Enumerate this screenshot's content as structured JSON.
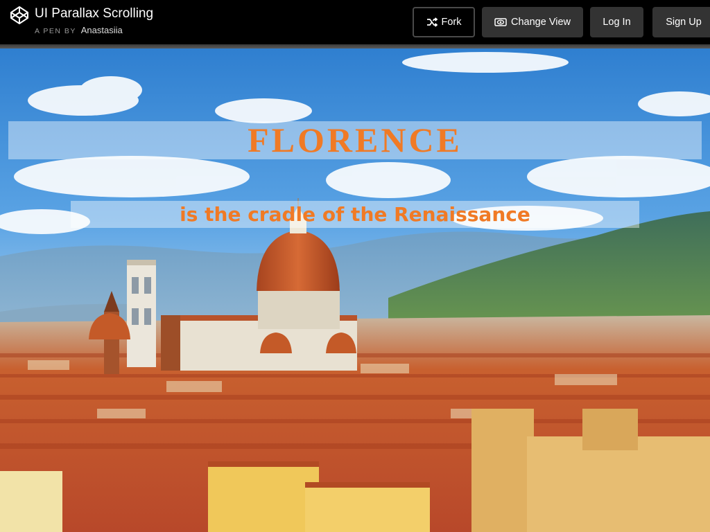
{
  "header": {
    "pen_title": "UI Parallax Scrolling",
    "byline_prefix": "A PEN BY",
    "author": "Anastasiia",
    "buttons": {
      "fork": "Fork",
      "change_view": "Change View",
      "log_in": "Log In",
      "sign_up": "Sign Up"
    }
  },
  "hero": {
    "headline": "FLORENCE",
    "subheadline": "is the cradle of the Renaissance"
  },
  "colors": {
    "accent": "#f07a25",
    "topbar": "#000000",
    "button_bg": "#333333",
    "sky": "#3f8fd8",
    "roofs": "#c8542a"
  },
  "icons": {
    "logo": "codepen-logo-icon",
    "fork": "fork-icon",
    "change_view": "eye-icon"
  }
}
